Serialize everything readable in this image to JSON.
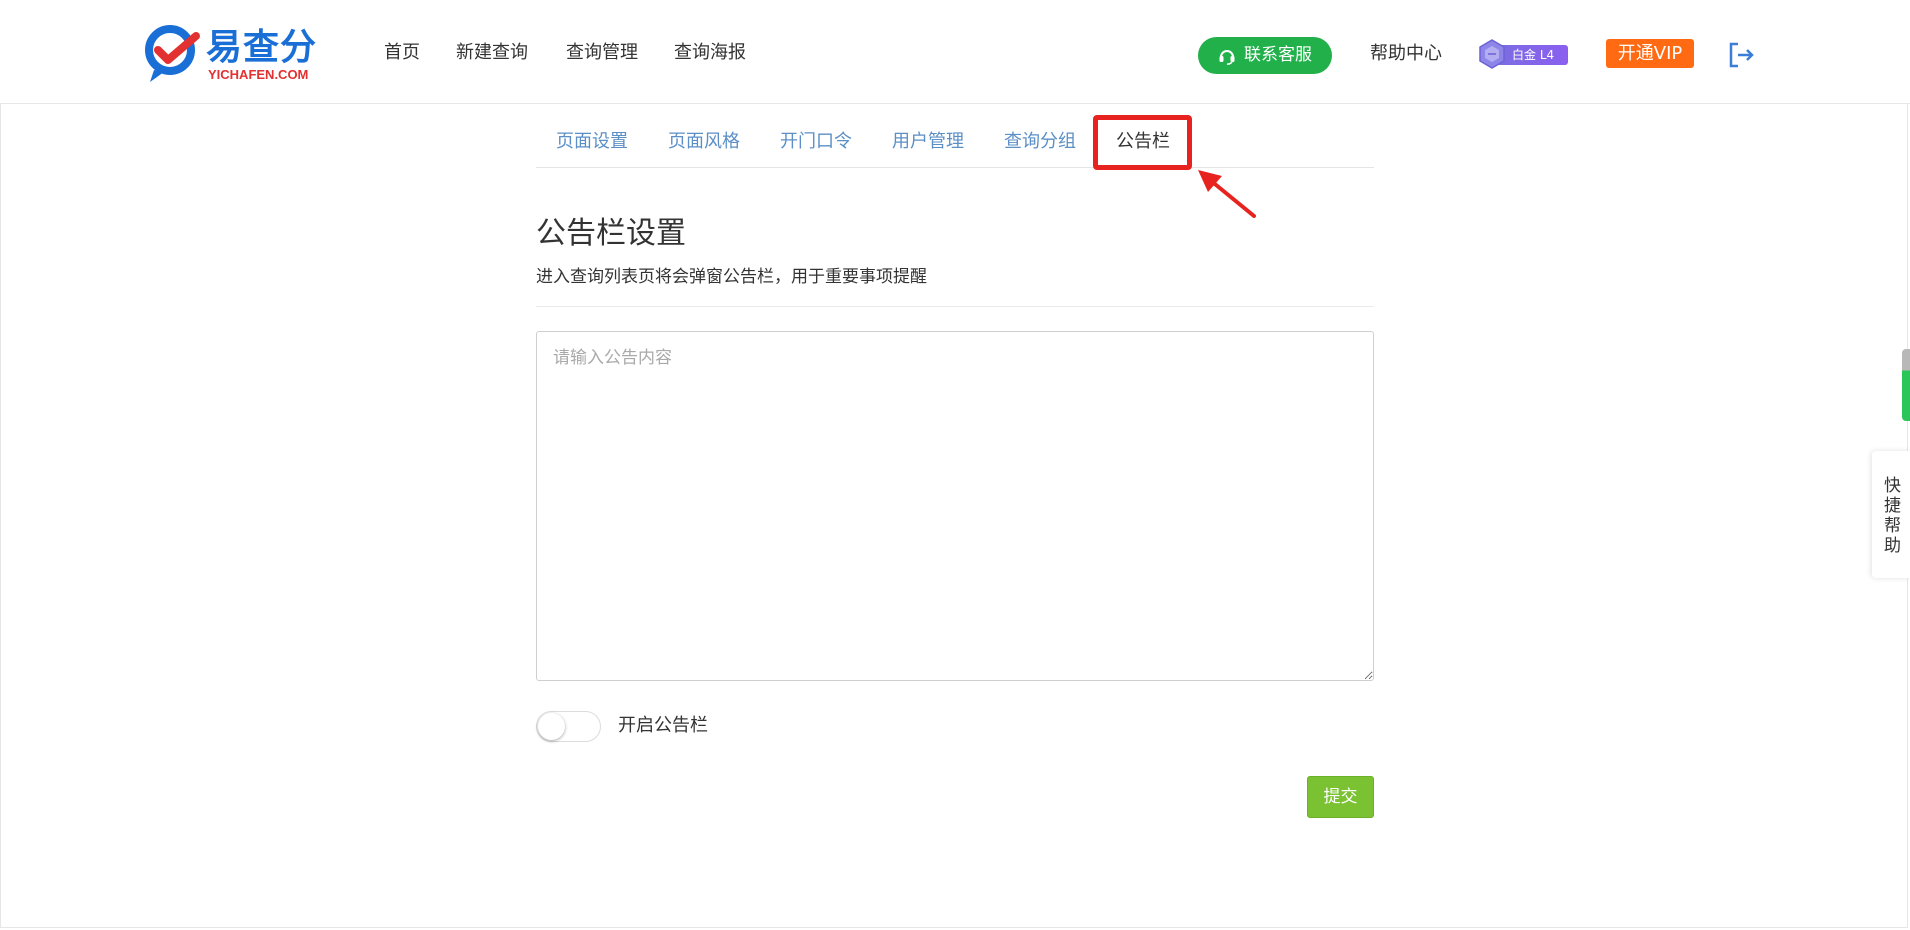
{
  "header": {
    "logo_text": "易查分",
    "logo_sub": "YICHAFEN.COM",
    "nav": [
      "首页",
      "新建查询",
      "查询管理",
      "查询海报"
    ],
    "customer_service": "联系客服",
    "help_center": "帮助中心",
    "level_badge": "白金 L4",
    "vip_button": "开通VIP"
  },
  "tabs": [
    {
      "label": "页面设置"
    },
    {
      "label": "页面风格"
    },
    {
      "label": "开门口令"
    },
    {
      "label": "用户管理"
    },
    {
      "label": "查询分组"
    },
    {
      "label": "公告栏",
      "active": true
    }
  ],
  "section": {
    "title": "公告栏设置",
    "description": "进入查询列表页将会弹窗公告栏，用于重要事项提醒"
  },
  "notice_input": {
    "placeholder": "请输入公告内容",
    "value": ""
  },
  "toggle": {
    "label": "开启公告栏",
    "enabled": false
  },
  "submit_label": "提交",
  "quick_help": "快捷帮助",
  "colors": {
    "brand_blue": "#1a6fd6",
    "cs_green": "#21b04a",
    "vip_orange": "#ff6a13",
    "submit_green": "#7ac231",
    "tab_blue": "#5b8fc6",
    "annotation_red": "#e8231f"
  },
  "icons": {
    "customer_service": "headset-icon",
    "logout": "logout-icon",
    "level": "hexagon-badge-icon"
  }
}
